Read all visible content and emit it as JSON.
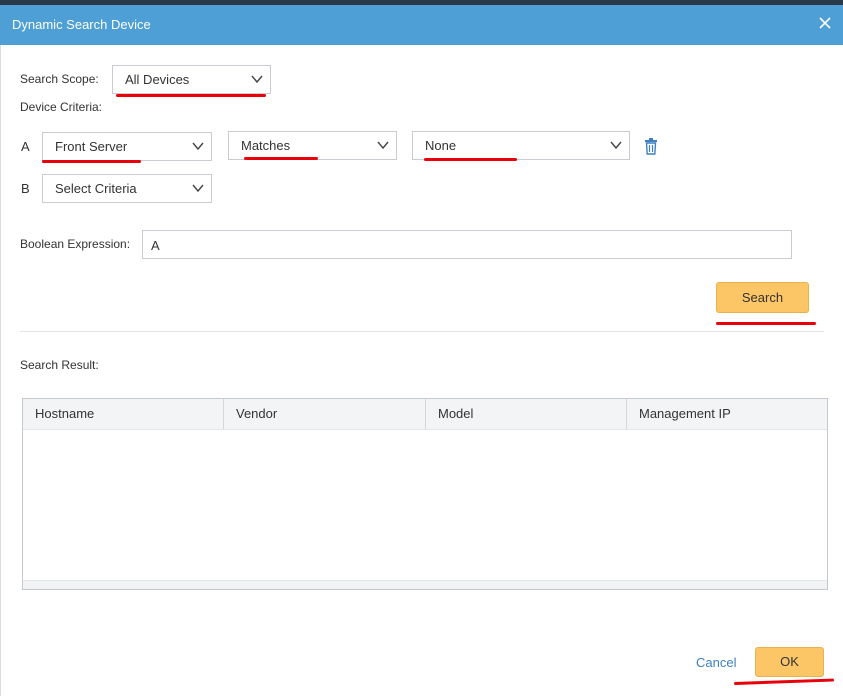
{
  "dialog": {
    "title": "Dynamic Search Device",
    "close_icon": "close-icon"
  },
  "scope": {
    "label": "Search Scope:",
    "value": "All Devices"
  },
  "criteria": {
    "label": "Device Criteria:",
    "rows": [
      {
        "letter": "A",
        "field": "Front Server",
        "operator": "Matches",
        "value": "None",
        "delete_icon": "trash-icon"
      },
      {
        "letter": "B",
        "field": "Select Criteria"
      }
    ]
  },
  "expression": {
    "label": "Boolean Expression:",
    "value": "A"
  },
  "search_button": "Search",
  "results": {
    "label": "Search Result:",
    "columns": [
      "Hostname",
      "Vendor",
      "Model",
      "Management IP"
    ],
    "rows": []
  },
  "footer": {
    "cancel": "Cancel",
    "ok": "OK"
  },
  "colors": {
    "titlebar": "#4e9fd5",
    "button": "#fcc666",
    "annotation": "#e8000b",
    "link": "#3d7fbf"
  }
}
